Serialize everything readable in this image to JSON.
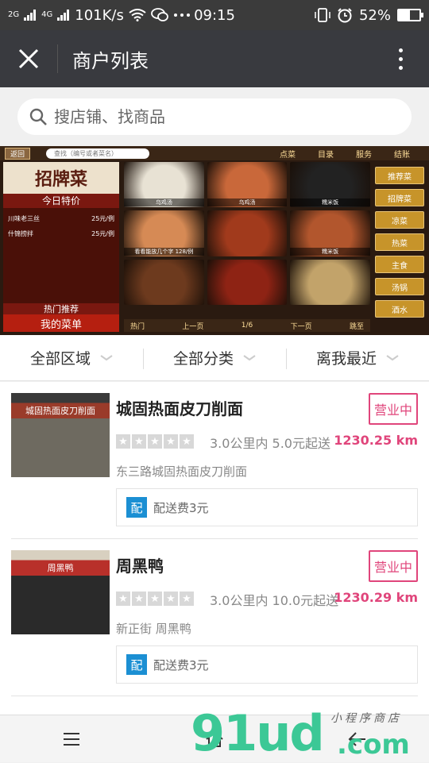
{
  "status_bar": {
    "network": "101K/s",
    "time": "09:15",
    "battery": "52%",
    "battery_level": 0.52,
    "signal_labels": [
      "2G",
      "4G",
      "2G"
    ]
  },
  "title_bar": {
    "title": "商户列表",
    "close_icon": "close-icon",
    "more_icon": "more-icon"
  },
  "search": {
    "placeholder": "搜店铺、找商品"
  },
  "banner": {
    "back": "返回",
    "search_placeholder": "查找（编号或者菜名）",
    "menu": [
      "点菜",
      "目录",
      "服务",
      "结账"
    ],
    "logo": "招牌菜",
    "today_special": "今日特价",
    "specials": [
      {
        "name": "川味老三丝",
        "price": "25元/例"
      },
      {
        "name": "什锦捞拌",
        "price": "25元/例"
      }
    ],
    "hot": "热门推荐",
    "my_menu": "我的菜单",
    "dishes": [
      "乌鸡汤",
      "乌鸡汤",
      "糯米饭",
      "看看能放几个字 128/例",
      "",
      "糯米饭",
      "",
      "",
      ""
    ],
    "dish_colors": [
      "#e8e2d4",
      "#c9683a",
      "#222222",
      "#d68a55",
      "#a13a1c",
      "#b2562d",
      "#6d3a1e",
      "#8e2314",
      "#c2a36a"
    ],
    "bottom": {
      "hot": "热门",
      "prev": "上一页",
      "page": "1/6",
      "next": "下一页",
      "jump": "跳至"
    },
    "categories": [
      "推荐菜",
      "招牌菜",
      "凉菜",
      "热菜",
      "主食",
      "汤锅",
      "酒水"
    ]
  },
  "filters": [
    "全部区域",
    "全部分类",
    "离我最近"
  ],
  "shops": [
    {
      "name": "城固热面皮刀削面",
      "status": "营业中",
      "meta": "3.0公里内 5.0元起送",
      "distance": "1230.25 km",
      "address": "东三路城固热面皮刀削面",
      "delivery_tag": "配",
      "delivery": "配送费3元",
      "rating": 0,
      "thumb_colors": [
        "#6e6a60",
        "#9a3b2a",
        "#3a3a3a"
      ],
      "sign_text": "城固热面皮刀削面"
    },
    {
      "name": "周黑鸭",
      "status": "营业中",
      "meta": "3.0公里内 10.0元起送",
      "distance": "1230.29 km",
      "address": "新正街 周黑鸭",
      "delivery_tag": "配",
      "delivery": "配送费3元",
      "rating": 0,
      "thumb_colors": [
        "#2a2a2a",
        "#b8302a",
        "#d8d0c0"
      ],
      "sign_text": "周黑鸭"
    }
  ],
  "bottom_bar": {
    "icons": [
      "menu-icon",
      "home-icon",
      "back-icon"
    ]
  },
  "watermark": {
    "big": "91ud",
    "com": ".com",
    "small": "小程序商店"
  },
  "colors": {
    "accent_pink": "#e0457b",
    "delivery_blue": "#1b8fd3",
    "title_bar": "#393a3f",
    "watermark_green": "#3cc896"
  }
}
